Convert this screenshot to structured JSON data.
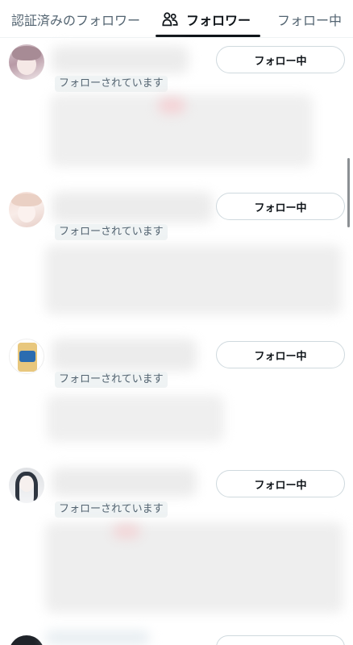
{
  "tabs": [
    {
      "label": "認証済みのフォロワー",
      "active": false
    },
    {
      "label": "フォロワー",
      "active": true,
      "icon": "people-icon"
    },
    {
      "label": "フォロー中",
      "active": false
    }
  ],
  "colors": {
    "text_primary": "#0f1419",
    "text_secondary": "#536471",
    "border": "#cfd9de",
    "badge_bg": "#eff3f4"
  },
  "users": [
    {
      "follows_you_label": "フォローされています",
      "follow_button_label": "フォロー中"
    },
    {
      "follows_you_label": "フォローされています",
      "follow_button_label": "フォロー中"
    },
    {
      "follows_you_label": "フォローされています",
      "follow_button_label": "フォロー中"
    },
    {
      "follows_you_label": "フォローされています",
      "follow_button_label": "フォロー中"
    }
  ]
}
